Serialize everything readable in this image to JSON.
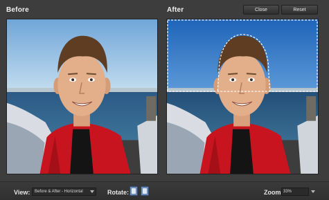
{
  "panes": {
    "before_label": "Before",
    "after_label": "After"
  },
  "header": {
    "close_label": "Close",
    "reset_label": "Reset"
  },
  "footer": {
    "view_label": "View:",
    "view_value": "Before & After - Horizontal",
    "rotate_label": "Rotate:",
    "zoom_label": "Zoom:",
    "zoom_value": "33%"
  },
  "icons": {
    "rotate_left": "rotate-left-icon",
    "rotate_right": "rotate-right-icon"
  },
  "colors": {
    "sky_before": "#8fb9de",
    "sky_after": "#2f78c6",
    "jacket": "#c8141e",
    "sea": "#2f5f86"
  }
}
